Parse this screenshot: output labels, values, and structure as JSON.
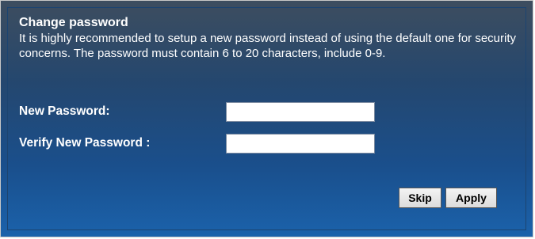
{
  "dialog": {
    "title": "Change password",
    "description": "It is highly recommended to setup a new password instead of using the default one for security concerns. The password must contain 6 to 20 characters, include 0-9."
  },
  "form": {
    "new_password_label": "New Password:",
    "new_password_value": "",
    "verify_password_label": "Verify New Password :",
    "verify_password_value": ""
  },
  "buttons": {
    "skip_label": "Skip",
    "apply_label": "Apply"
  },
  "colors": {
    "panel_top": "#3d4d5f",
    "panel_bottom": "#1b62ab",
    "text": "#ffffff"
  }
}
